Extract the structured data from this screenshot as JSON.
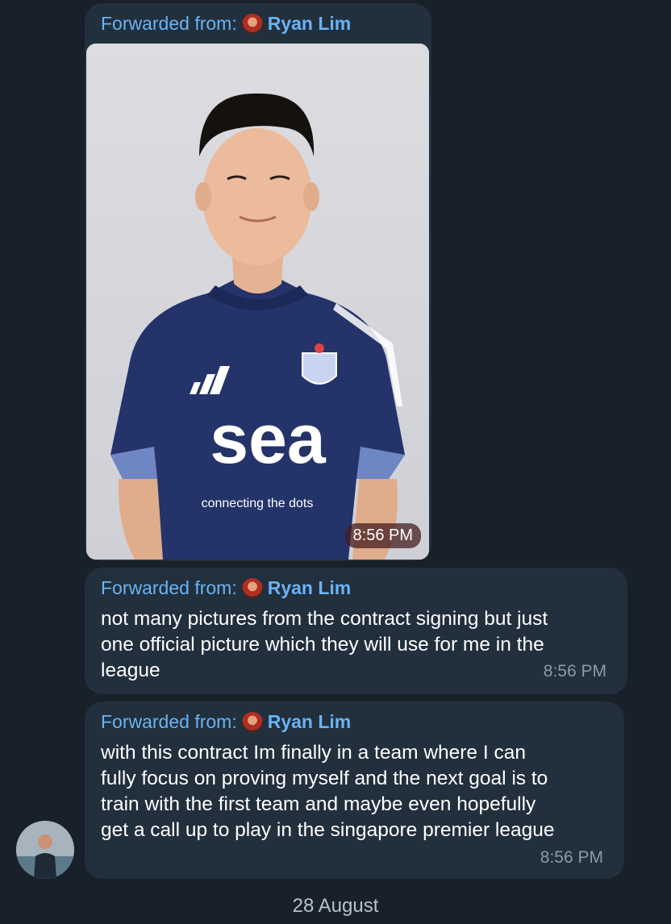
{
  "messages": [
    {
      "forwarded_label": "Forwarded from:",
      "forwarded_name": "Ryan Lim",
      "photo_caption_brand": "sea",
      "photo_caption_tagline": "connecting the dots",
      "time": "8:56 PM"
    },
    {
      "forwarded_label": "Forwarded from:",
      "forwarded_name": "Ryan Lim",
      "text_lines": [
        "not many pictures from the contract signing but just",
        "one official picture which they will use for me in the",
        "league"
      ],
      "time": "8:56 PM"
    },
    {
      "forwarded_label": "Forwarded from:",
      "forwarded_name": "Ryan Lim",
      "text_lines": [
        "with this contract Im finally in a team where I can",
        "fully focus on proving myself and the next goal is to",
        "train with the first team and maybe even hopefully",
        "get a call up to play in the singapore premier league"
      ],
      "time": "8:56 PM"
    }
  ],
  "date_separator": "28 August",
  "colors": {
    "background": "#182029",
    "bubble": "#222f3d",
    "link": "#6ab3f3",
    "time": "#8a9aa9"
  }
}
